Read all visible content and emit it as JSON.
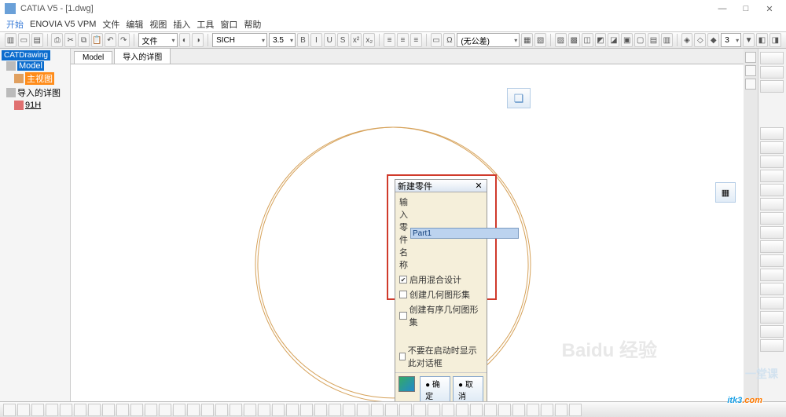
{
  "title": "CATIA V5 - [1.dwg]",
  "window_controls": {
    "min": "—",
    "max": "□",
    "close": "✕"
  },
  "menu": {
    "start": "开始",
    "enovia": "ENOVIA V5 VPM",
    "file": "文件",
    "edit": "编辑",
    "view": "视图",
    "insert": "插入",
    "tools": "工具",
    "window": "窗口",
    "help": "帮助"
  },
  "toolbar": {
    "dd_file": "文件",
    "dd_sich": "SICH",
    "dd_35": "3.5",
    "dd_tol": "(无公差)",
    "dd_num": "3"
  },
  "tree": {
    "root": "CATDrawing",
    "n1": "Model",
    "n2": "主视图",
    "n3": "导入的详图",
    "n4": "91H"
  },
  "tabs": {
    "t1": "Model",
    "t2": "导入的详图"
  },
  "dialog": {
    "title": "新建零件",
    "label_name": "输入零件名称",
    "input_value": "Part1",
    "chk1_label": "启用混合设计",
    "chk2_label": "创建几何图形集",
    "chk3_label": "创建有序几何图形集",
    "chk4_label": "不要在启动时显示此对话框",
    "ok": "● 确定",
    "cancel": "● 取消"
  },
  "watermark": {
    "brand_a": "itk3",
    "brand_b": ".com",
    "baidu": "Baidu 经验",
    "ketang": "一堂课"
  }
}
